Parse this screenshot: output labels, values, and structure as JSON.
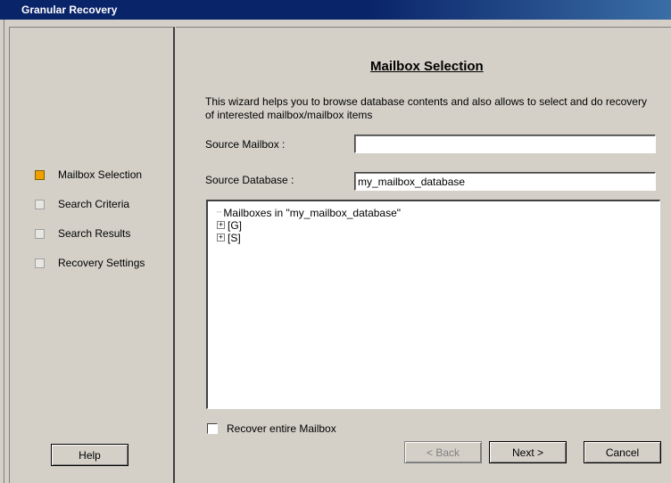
{
  "window": {
    "title": "Granular Recovery"
  },
  "steps": [
    {
      "label": "Mailbox Selection",
      "active": true
    },
    {
      "label": "Search Criteria",
      "active": false
    },
    {
      "label": "Search Results",
      "active": false
    },
    {
      "label": "Recovery Settings",
      "active": false
    }
  ],
  "help_button": {
    "label": "Help"
  },
  "main": {
    "heading": "Mailbox Selection",
    "description": "This wizard helps you to browse database contents and also allows to select and do recovery of interested mailbox/mailbox items",
    "source_mailbox": {
      "label": "Source Mailbox :",
      "value": ""
    },
    "source_database": {
      "label": "Source Database :",
      "value": "my_mailbox_database"
    },
    "tree": {
      "root": "Mailboxes in \"my_mailbox_database\"",
      "children": [
        "[G]",
        "[S]"
      ]
    },
    "recover_entire": {
      "label": "Recover entire Mailbox",
      "checked": false
    }
  },
  "buttons": {
    "back": "< Back",
    "next": "Next >",
    "cancel": "Cancel"
  },
  "colors": {
    "title_bar": "#0a246a",
    "active_step": "#f0a000",
    "face": "#d4d0c8"
  }
}
